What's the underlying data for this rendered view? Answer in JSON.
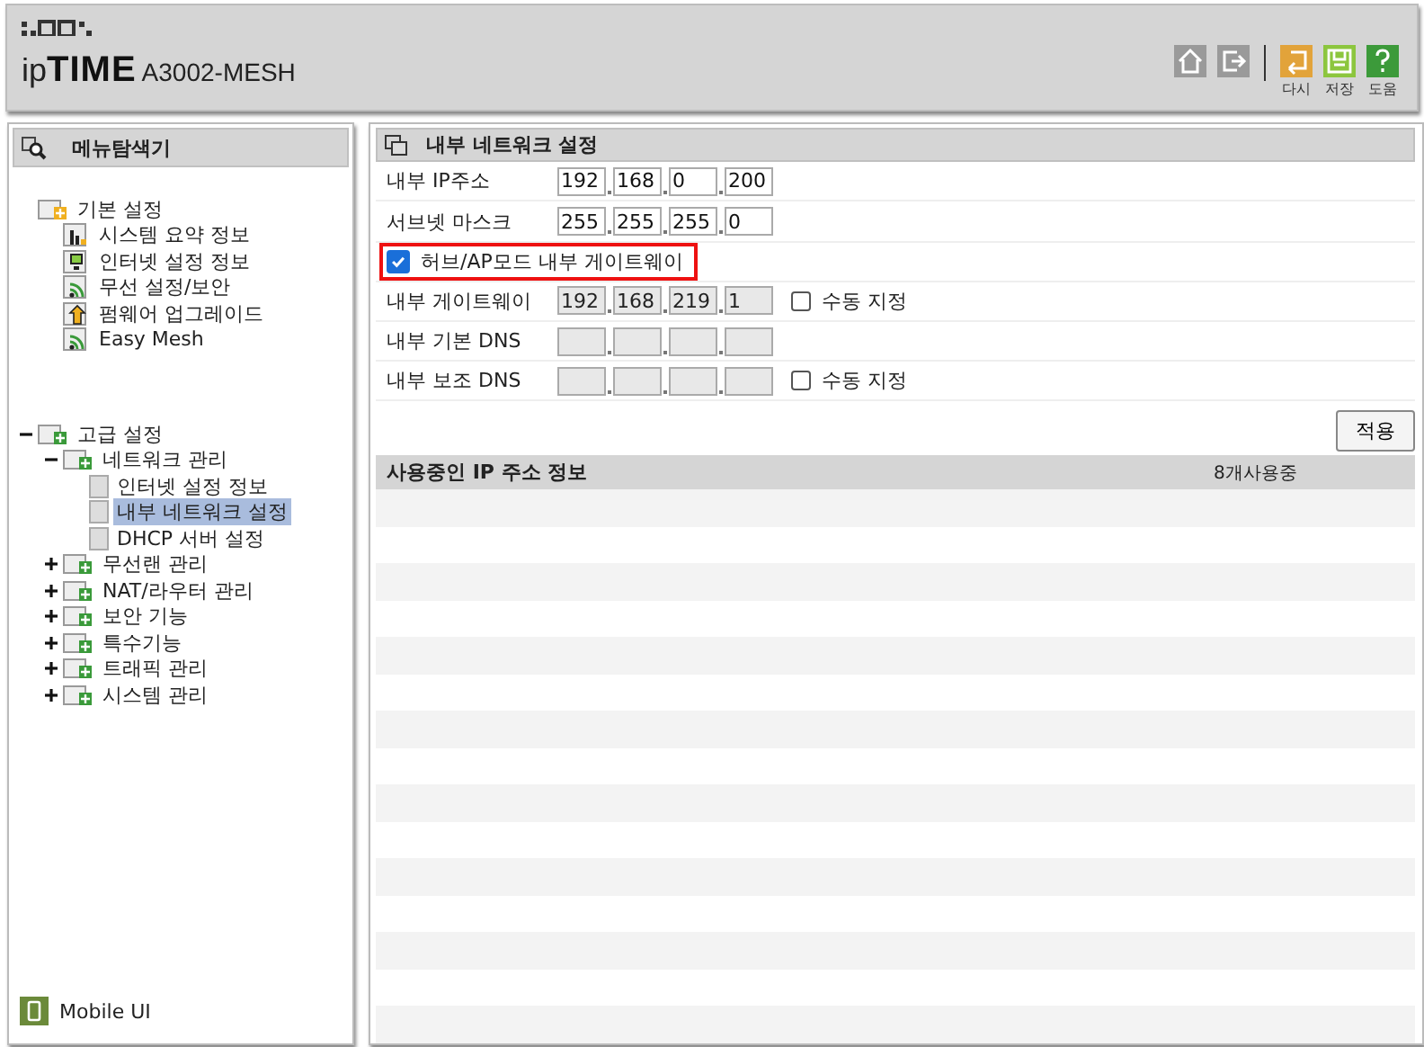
{
  "header": {
    "logo_prefix": "ip",
    "logo_main": "TIME",
    "model": "A3002-MESH",
    "tools": [
      {
        "kind": "home"
      },
      {
        "kind": "logout"
      },
      {
        "kind": "undo",
        "label": "다시"
      },
      {
        "kind": "save",
        "label": "저장"
      },
      {
        "kind": "help",
        "label": "도움"
      }
    ]
  },
  "sidebar": {
    "title": "메뉴탐색기",
    "tree": [
      {
        "label": "기본 설정",
        "kind": "root",
        "children": [
          {
            "label": "시스템 요약 정보",
            "kind": "chart",
            "selected": false
          },
          {
            "label": "인터넷 설정 정보",
            "kind": "monitor",
            "selected": false
          },
          {
            "label": "무선 설정/보안",
            "kind": "wifi",
            "selected": false
          },
          {
            "label": "펌웨어 업그레이드",
            "kind": "upgrade",
            "selected": false
          },
          {
            "label": "Easy Mesh",
            "kind": "wifi",
            "selected": false
          }
        ]
      },
      {
        "label": "고급 설정",
        "kind": "group",
        "expanded": true,
        "children": [
          {
            "label": "네트워크 관리",
            "kind": "group",
            "expanded": true,
            "children": [
              {
                "label": "인터넷 설정 정보",
                "kind": "page",
                "selected": false
              },
              {
                "label": "내부 네트워크 설정",
                "kind": "page",
                "selected": true
              },
              {
                "label": "DHCP 서버 설정",
                "kind": "page",
                "selected": false
              }
            ]
          },
          {
            "label": "무선랜 관리",
            "kind": "group",
            "expanded": false
          },
          {
            "label": "NAT/라우터 관리",
            "kind": "group",
            "expanded": false
          },
          {
            "label": "보안 기능",
            "kind": "group",
            "expanded": false
          },
          {
            "label": "특수기능",
            "kind": "group",
            "expanded": false
          },
          {
            "label": "트래픽 관리",
            "kind": "group",
            "expanded": false
          },
          {
            "label": "시스템 관리",
            "kind": "group",
            "expanded": false
          }
        ]
      }
    ],
    "footer": "Mobile UI"
  },
  "panel": {
    "title": "내부 네트워크 설정",
    "rows": [
      {
        "kind": "ip",
        "label": "내부 IP주소",
        "disabled": false,
        "octets": [
          "192",
          "168",
          "0",
          "200"
        ]
      },
      {
        "kind": "ip",
        "label": "서브넷 마스크",
        "disabled": false,
        "octets": [
          "255",
          "255",
          "255",
          "0"
        ]
      },
      {
        "kind": "checkbox",
        "label": "허브/AP모드 내부 게이트웨이",
        "checked": true,
        "highlighted": true
      },
      {
        "kind": "ip",
        "label": "내부 게이트웨이",
        "disabled": true,
        "octets": [
          "192",
          "168",
          "219",
          "1"
        ],
        "manual": {
          "label": "수동 지정",
          "checked": false
        }
      },
      {
        "kind": "ip",
        "label": "내부 기본 DNS",
        "disabled": true
      },
      {
        "kind": "ip",
        "label": "내부 보조 DNS",
        "disabled": true,
        "manual": {
          "label": "수동 지정",
          "checked": false
        }
      }
    ],
    "apply": "적용",
    "table": {
      "title": "사용중인 IP 주소 정보",
      "count": "8개사용중"
    }
  }
}
